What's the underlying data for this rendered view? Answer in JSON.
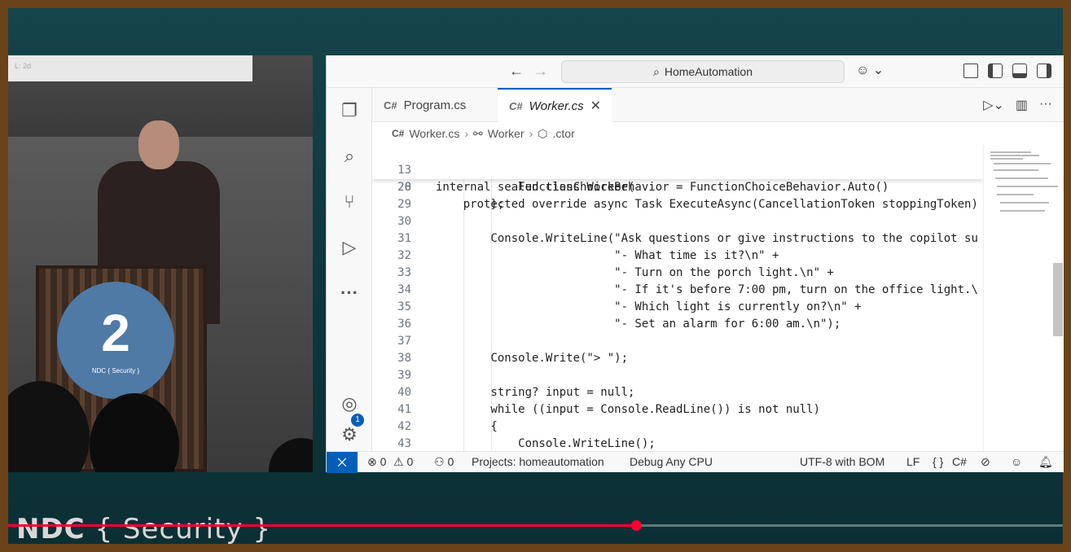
{
  "camera": {
    "screen_text": "L: 2d",
    "badge_number": "2",
    "badge_label": "NDC { Security }"
  },
  "titlebar": {
    "back_icon": "arrow-left-icon",
    "forward_icon": "arrow-right-icon",
    "search_text": "HomeAutomation",
    "copilot_chevron": "⌄"
  },
  "activity": {
    "explorer": "files-icon",
    "search": "search-icon",
    "scm": "source-control-icon",
    "debug": "run-debug-icon",
    "more": "···",
    "account_badge": "1"
  },
  "tabs": [
    {
      "label": "Program.cs",
      "icon": "C#",
      "active": false
    },
    {
      "label": "Worker.cs",
      "icon": "C#",
      "active": true,
      "close": "✕"
    }
  ],
  "breadcrumb": {
    "file": "Worker.cs",
    "class": "Worker",
    "member": ".ctor",
    "sep": "›"
  },
  "sticky": [
    {
      "ln": "13",
      "code": "internal sealed class Worker("
    },
    {
      "ln": "20",
      "code": "    protected override async Task ExecuteAsync(CancellationToken stoppingToken)"
    }
  ],
  "lines": [
    {
      "ln": "28",
      "code": "            FunctionChoiceBehavior = FunctionChoiceBehavior.Auto()"
    },
    {
      "ln": "29",
      "code": "        };"
    },
    {
      "ln": "30",
      "code": ""
    },
    {
      "ln": "31",
      "code": "        Console.WriteLine(\"Ask questions or give instructions to the copilot su"
    },
    {
      "ln": "32",
      "code": "                          \"- What time is it?\\n\" +"
    },
    {
      "ln": "33",
      "code": "                          \"- Turn on the porch light.\\n\" +"
    },
    {
      "ln": "34",
      "code": "                          \"- If it's before 7:00 pm, turn on the office light.\\"
    },
    {
      "ln": "35",
      "code": "                          \"- Which light is currently on?\\n\" +"
    },
    {
      "ln": "36",
      "code": "                          \"- Set an alarm for 6:00 am.\\n\");"
    },
    {
      "ln": "37",
      "code": ""
    },
    {
      "ln": "38",
      "code": "        Console.Write(\"> \");"
    },
    {
      "ln": "39",
      "code": ""
    },
    {
      "ln": "40",
      "code": "        string? input = null;"
    },
    {
      "ln": "41",
      "code": "        while ((input = Console.ReadLine()) is not null)"
    },
    {
      "ln": "42",
      "code": "        {"
    },
    {
      "ln": "43",
      "code": "            Console.WriteLine();"
    }
  ],
  "statusbar": {
    "remote_icon": "remote-icon",
    "errors": "⊗ 0",
    "warnings": "⚠ 0",
    "ports": "0",
    "project": "Projects: homeautomation",
    "config": "Debug Any CPU",
    "encoding": "UTF-8 with BOM",
    "eol": "LF",
    "braces": "{ }",
    "language": "C#"
  },
  "overlay": {
    "logo_bold": "NDC",
    "logo_rest": " { Security }",
    "progress": 0.595
  }
}
